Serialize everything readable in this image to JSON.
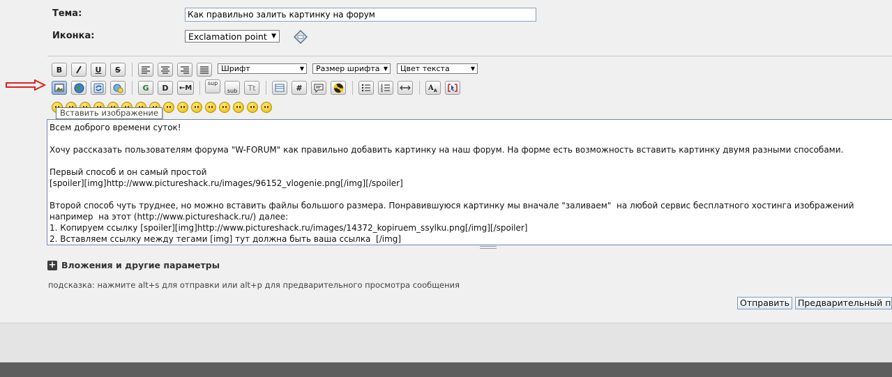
{
  "form": {
    "subject_label": "Тема:",
    "subject_value": "Как правильно залить картинку на форум",
    "icon_label": "Иконка:",
    "icon_value": "Exclamation point"
  },
  "toolbar": {
    "row1": {
      "bold": "B",
      "italic": "I",
      "underline": "U",
      "strike": "S",
      "font": "Шрифт",
      "size": "Размер шрифта",
      "color": "Цвет текста"
    },
    "row2": {
      "sup": "sup",
      "sub": "sub",
      "tt": "Tt",
      "hash": "#",
      "m": "←M",
      "g": "G",
      "d": "D"
    },
    "tooltip": "Вставить изображение"
  },
  "editor": {
    "text": "Всем доброго времени суток!\n\nХочу рассказать пользователям форума \"W-FORUM\" как правильно добавить картинку на наш форум. На форме есть возможность вставить картинку двумя разными способами.\n\nПервый способ и он самый простой\n[spoiler][img]http://www.pictureshack.ru/images/96152_vlogenie.png[/img][/spoiler]\n\nВторой способ чуть труднее, но можно вставить файлы большого размера. Понравившуюся картинку мы вначале \"заливаем\"  на любой сервис бесплатного хостинга изображений например  на этот (http://www.pictureshack.ru/) далее:\n1. Копируем ссылку [spoiler][img]http://www.pictureshack.ru/images/14372_kopiruem_ssylku.png[/img][/spoiler]\n2. Вставляем ссылку между тегами [img] тут должна быть ваша ссылка  [/img]"
  },
  "attachments_label": "Вложения и другие параметры",
  "hint": "подсказка: нажмите alt+s для отправки или alt+p для предварительного просмотра сообщения",
  "buttons": {
    "submit": "Отправить",
    "preview": "Предварительный пр"
  },
  "colors": {
    "arrow": "#e02020",
    "editor_border": "#6d88ad"
  }
}
